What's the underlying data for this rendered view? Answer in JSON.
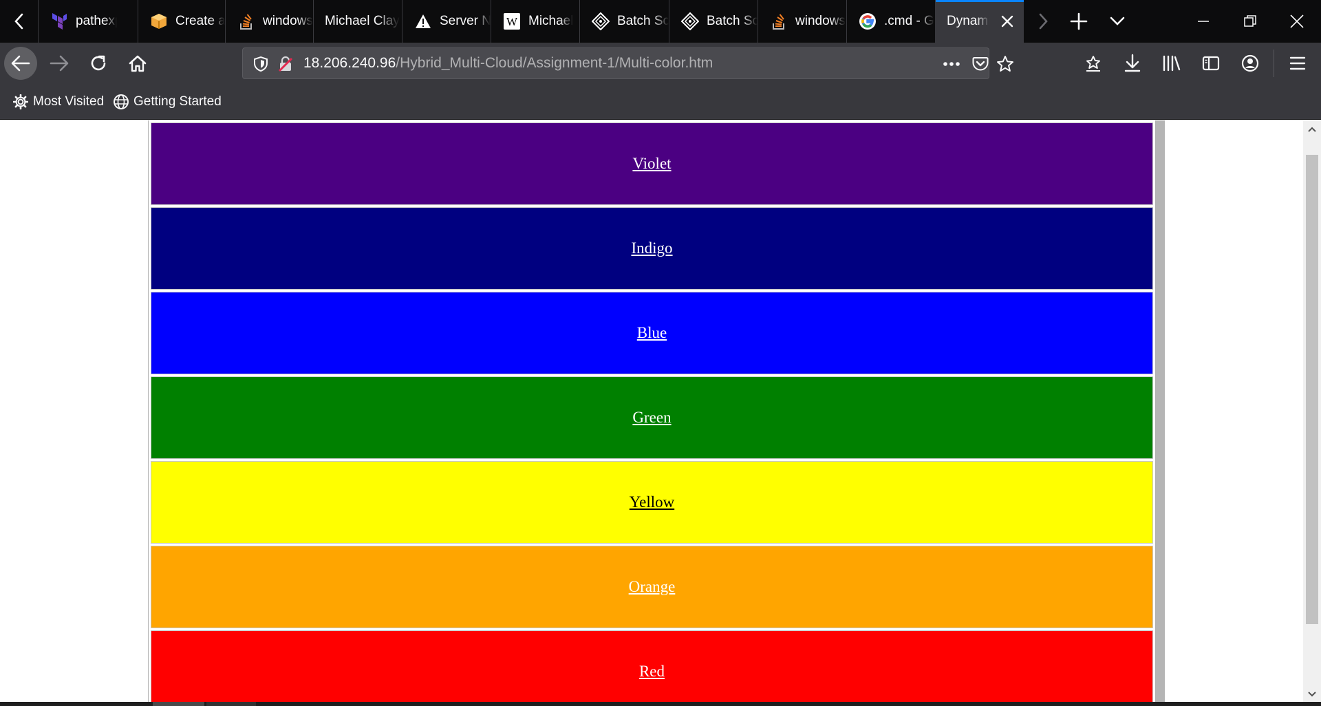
{
  "tabs": [
    {
      "label": "pathexp",
      "icon": "terraform-icon",
      "icon_color": "#7b42bc"
    },
    {
      "label": "Create a",
      "icon": "aws-box-icon",
      "icon_color": "#f2a73b"
    },
    {
      "label": "windows",
      "icon": "stackoverflow-icon",
      "icon_color": "#f48024"
    },
    {
      "label": "Michael Clay",
      "icon": "",
      "icon_color": ""
    },
    {
      "label": "Server N",
      "icon": "warning-icon",
      "icon_color": "#ffffff"
    },
    {
      "label": "Michael",
      "icon": "wikipedia-icon",
      "icon_color": "#ffffff"
    },
    {
      "label": "Batch Sc",
      "icon": "batch-script-icon",
      "icon_color": "#ffffff"
    },
    {
      "label": "Batch Sc",
      "icon": "batch-script-icon",
      "icon_color": "#ffffff"
    },
    {
      "label": "windows",
      "icon": "stackoverflow-icon",
      "icon_color": "#f48024"
    },
    {
      "label": ".cmd - G",
      "icon": "google-icon",
      "icon_color": "#4285f4"
    },
    {
      "label": "Dynami",
      "icon": "",
      "icon_color": "",
      "active": true
    }
  ],
  "url": {
    "host": "18.206.240.96",
    "path": "/Hybrid_Multi-Cloud/Assignment-1/Multi-color.htm"
  },
  "bookmarks": [
    {
      "label": "Most Visited",
      "icon": "gear-icon"
    },
    {
      "label": "Getting Started",
      "icon": "globe-icon"
    }
  ],
  "colors": [
    {
      "label": "Violet",
      "bg": "#4b0082",
      "fg": "#ffffff"
    },
    {
      "label": "Indigo",
      "bg": "#000080",
      "fg": "#ffffff"
    },
    {
      "label": "Blue",
      "bg": "#0000ff",
      "fg": "#ffffff"
    },
    {
      "label": "Green",
      "bg": "#008000",
      "fg": "#ffffff"
    },
    {
      "label": "Yellow",
      "bg": "#ffff00",
      "fg": "#000000"
    },
    {
      "label": "Orange",
      "bg": "#ffa500",
      "fg": "#ffffff"
    },
    {
      "label": "Red",
      "bg": "#ff0000",
      "fg": "#ffffff"
    }
  ],
  "theme": {
    "tabstrip_bg": "#0c0c0d",
    "toolbar_bg": "#38383d",
    "active_tab_accent": "#0a84ff",
    "urlbar_bg": "#4a4a4f"
  }
}
